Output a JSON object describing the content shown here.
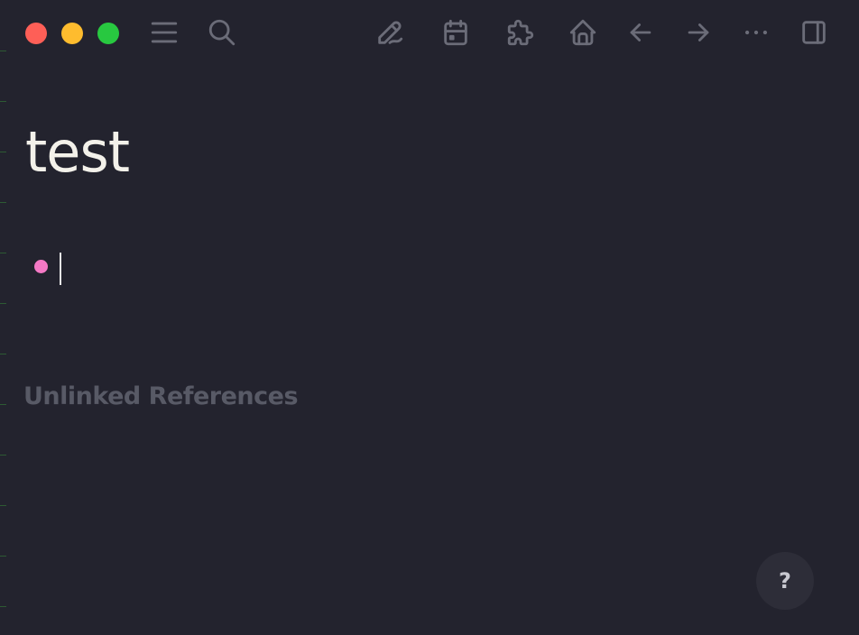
{
  "toolbar": {
    "icons": {
      "menu": "menu-icon",
      "search": "search-icon",
      "edit": "pencil-icon",
      "journals": "calendar-icon",
      "plugins": "puzzle-icon",
      "home": "home-icon",
      "back": "arrow-left-icon",
      "forward": "arrow-right-icon",
      "more": "ellipsis-icon",
      "sidebar": "sidebar-toggle-icon"
    }
  },
  "page": {
    "title": "test",
    "blocks": [
      {
        "text": ""
      }
    ]
  },
  "references": {
    "unlinked_heading": "Unlinked References"
  },
  "help": {
    "label": "?"
  },
  "colors": {
    "background": "#23232e",
    "bullet": "#f479c5",
    "title": "#f3f1ea",
    "muted": "#585a66",
    "icon": "#6b6c78",
    "close": "#fe5f57",
    "minimize": "#febc2e",
    "maximize": "#28c840"
  }
}
